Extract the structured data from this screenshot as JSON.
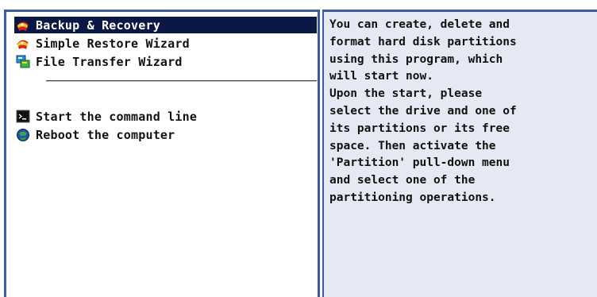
{
  "menu": {
    "items": [
      {
        "label": "Backup & Recovery",
        "icon": "backup-recovery-icon",
        "selected": true
      },
      {
        "label": "Simple Restore Wizard",
        "icon": "restore-wizard-icon",
        "selected": false
      },
      {
        "label": "File Transfer Wizard",
        "icon": "file-transfer-icon",
        "selected": false
      },
      {
        "label": "Start the command line",
        "icon": "terminal-icon",
        "selected": false
      },
      {
        "label": "Reboot the computer",
        "icon": "reboot-icon",
        "selected": false
      }
    ]
  },
  "description": {
    "text": "You can create, delete and\nformat hard disk partitions\nusing this program, which\nwill start now.\nUpon the start, please\nselect the drive and one of\nits partitions or its free\nspace. Then activate the\n'Partition' pull-down menu\nand select one of the\npartitioning operations."
  },
  "colors": {
    "border": "#3a5da6",
    "selection": "#0b1846",
    "description_background": "#e6e9f3"
  }
}
